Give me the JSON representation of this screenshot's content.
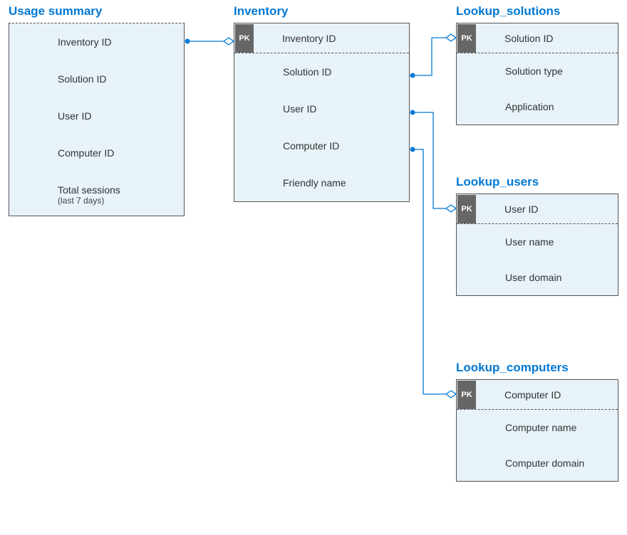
{
  "tables": {
    "usage": {
      "title": "Usage summary",
      "fields": [
        "Inventory ID",
        "Solution ID",
        "User  ID",
        "Computer ID",
        "Total sessions"
      ],
      "sub": "(last 7 days)"
    },
    "inventory": {
      "title": "Inventory",
      "pk": "PK",
      "pkField": "Inventory ID",
      "fields": [
        "Solution ID",
        "User ID",
        "Computer ID",
        "Friendly name"
      ]
    },
    "solutions": {
      "title": "Lookup_solutions",
      "pk": "PK",
      "pkField": "Solution ID",
      "fields": [
        "Solution type",
        "Application"
      ]
    },
    "users": {
      "title": "Lookup_users",
      "pk": "PK",
      "pkField": "User ID",
      "fields": [
        "User name",
        "User domain"
      ]
    },
    "computers": {
      "title": "Lookup_computers",
      "pk": "PK",
      "pkField": "Computer ID",
      "fields": [
        "Computer name",
        "Computer domain"
      ]
    }
  }
}
